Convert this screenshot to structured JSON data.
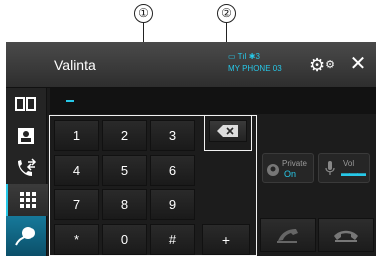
{
  "callouts": {
    "one": "①",
    "two": "②"
  },
  "header": {
    "title": "Valinta",
    "status_icons": "▭ Tıl ✱3",
    "phone_name": "MY PHONE 03",
    "close_label": "✕"
  },
  "entry": {
    "value": ""
  },
  "keypad": {
    "keys": [
      "1",
      "2",
      "3",
      "4",
      "5",
      "6",
      "7",
      "8",
      "9",
      "*",
      "0",
      "#",
      "+"
    ]
  },
  "controls": {
    "private_label": "Private",
    "private_value": "On",
    "vol_label": "Vol",
    "vol_value": "▬▬▬"
  },
  "colors": {
    "accent": "#27c8e8",
    "background": "#1c1c1c"
  }
}
